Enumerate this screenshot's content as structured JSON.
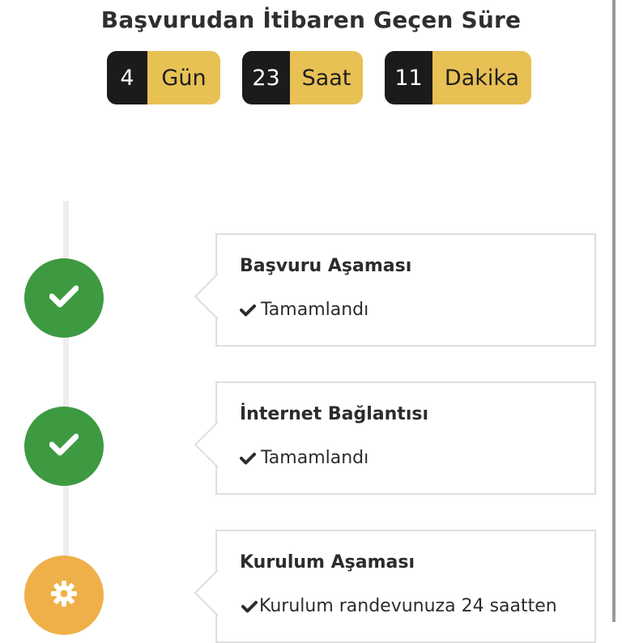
{
  "header": {
    "title": "Başvurudan İtibaren Geçen Süre"
  },
  "timers": [
    {
      "value": "4",
      "unit": "Gün"
    },
    {
      "value": "23",
      "unit": "Saat"
    },
    {
      "value": "11",
      "unit": "Dakika"
    }
  ],
  "steps": [
    {
      "title": "Başvuru Aşaması",
      "status": "Tamamlandı",
      "state": "done",
      "icon": "check-icon"
    },
    {
      "title": "İnternet Bağlantısı",
      "status": "Tamamlandı",
      "state": "done",
      "icon": "check-icon"
    },
    {
      "title": "Kurulum Aşaması",
      "status": "Kurulum randevunuza 24 saatten",
      "state": "in-progress",
      "icon": "gear-icon"
    }
  ],
  "colors": {
    "done": "#3d9a41",
    "in_progress": "#efb049",
    "timer_dark": "#1b1b1b",
    "timer_accent": "#e8c154"
  }
}
